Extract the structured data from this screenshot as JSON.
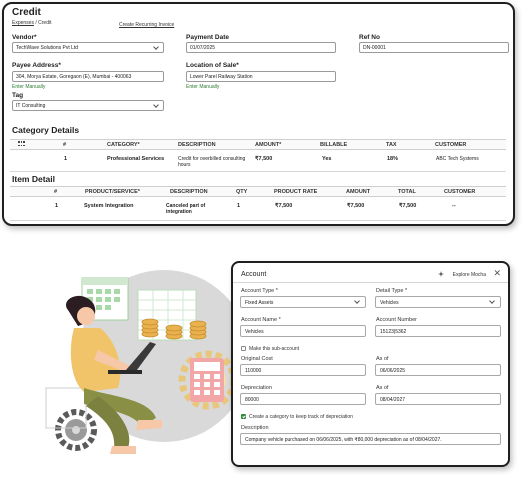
{
  "credit": {
    "title": "Credit",
    "breadcrumb": {
      "parent": "Expenses",
      "separator": "/",
      "current": "Credit"
    },
    "recurring_link": "Create Recurring Invoice",
    "vendor": {
      "label": "Vendor*",
      "value": "TechWave Solutions Pvt Ltd"
    },
    "payment_date": {
      "label": "Payment Date",
      "value": "01/07/2025"
    },
    "ref_no": {
      "label": "Ref No",
      "value": "DN-00001"
    },
    "payee_address": {
      "label": "Payee Address*",
      "value": "304, Morya Estate, Goregaon (E), Mumbai - 400063",
      "enter_manually": "Enter Manually"
    },
    "location_of_sale": {
      "label": "Location of Sale*",
      "value": "Lower Parel Railway Station",
      "enter_manually": "Enter Manually"
    },
    "tag": {
      "label": "Tag",
      "value": "IT Consulting"
    }
  },
  "category_details": {
    "title": "Category Details",
    "columns": [
      "#",
      "CATEGORY*",
      "DESCRIPTION",
      "AMOUNT*",
      "BILLABLE",
      "TAX",
      "CUSTOMER"
    ],
    "rows": [
      {
        "num": "1",
        "category": "Professional Services",
        "description": "Credit for overbilled consulting hours",
        "amount": "₹7,500",
        "billable": "Yes",
        "tax": "18%",
        "customer": "ABC Tech Systems"
      }
    ]
  },
  "item_detail": {
    "title": "Item Detail",
    "columns": [
      "#",
      "PRODUCT/SERVICE*",
      "DESCRIPTION",
      "QTY",
      "PRODUCT RATE",
      "AMOUNT",
      "TOTAL",
      "CUSTOMER"
    ],
    "rows": [
      {
        "num": "1",
        "product": "System Integration",
        "description": "Canceled part of integration",
        "qty": "1",
        "rate": "₹7,500",
        "amount": "₹7,500",
        "total": "₹7,500",
        "customer": "--"
      }
    ]
  },
  "account": {
    "title": "Account",
    "explore": "Explore Mocha",
    "close": "✕",
    "account_type": {
      "label": "Account Type *",
      "value": "Fixed Assets"
    },
    "detail_type": {
      "label": "Detail Type *",
      "value": "Vehicles"
    },
    "account_name": {
      "label": "Account Name *",
      "value": "Vehicles"
    },
    "account_number": {
      "label": "Account Number",
      "value": "15123|5362"
    },
    "sub_account": {
      "label": "Make this sub-account",
      "checked": false
    },
    "original_cost": {
      "label": "Original Cost",
      "value": "110000"
    },
    "as_of_1": {
      "label": "As of",
      "value": "06/06/2025"
    },
    "depreciation": {
      "label": "Depreciation",
      "value": "80000"
    },
    "as_of_2": {
      "label": "As of",
      "value": "08/04/2027"
    },
    "track_category": {
      "label": "Create a category to keep track of depreciation",
      "checked": true
    },
    "description": {
      "label": "Description",
      "value": "Company vehicle purchased on 06/06/2025, with ₹80,000 depreciation as of 08/04/2027."
    }
  },
  "colors": {
    "accent_green": "#2e8b3a",
    "illustration_bg": "#d9d9d9",
    "coin": "#e9b24f",
    "shirt": "#f2c469",
    "pants": "#8a8f46",
    "hair": "#2b1d22",
    "calculator": "#f2a6a6",
    "gear": "#5a5a5a"
  }
}
